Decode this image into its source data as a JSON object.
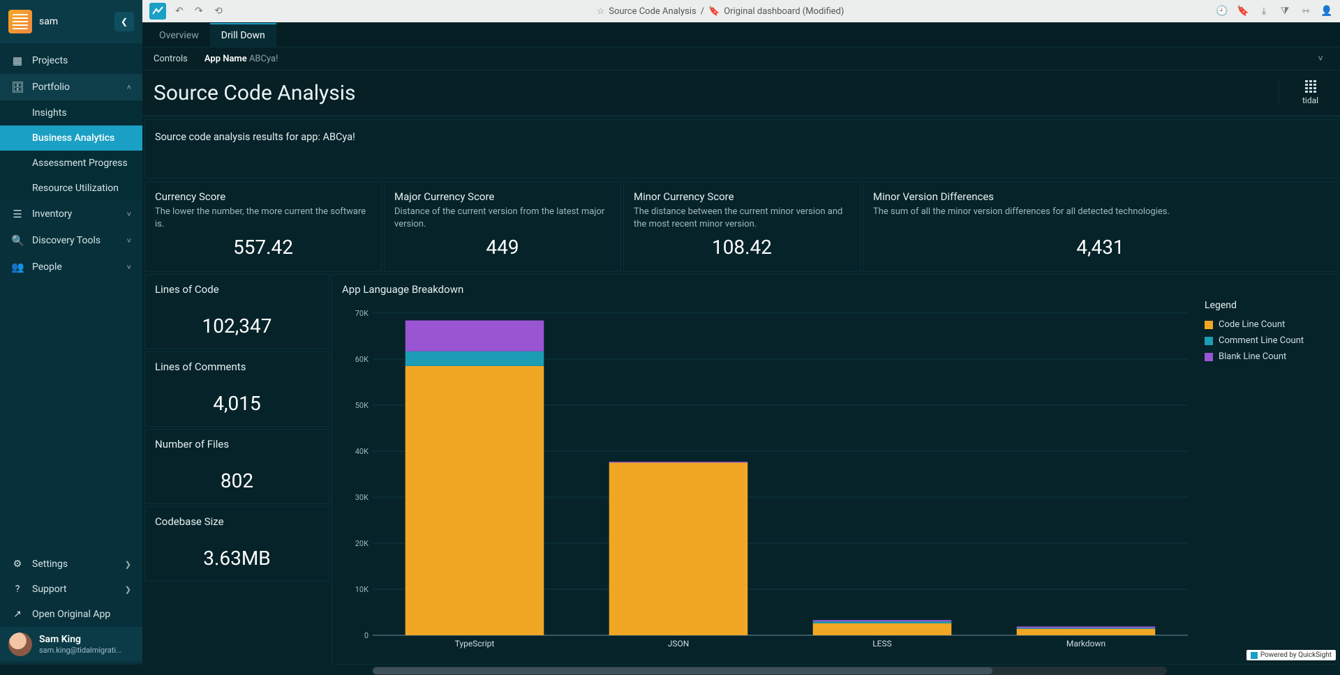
{
  "sidebar": {
    "user_short": "sam",
    "items": [
      {
        "icon": "▦",
        "label": "Projects",
        "expandable": false
      },
      {
        "icon": "🗄",
        "label": "Portfolio",
        "expandable": true,
        "expanded": true,
        "children": [
          {
            "label": "Insights",
            "active": false
          },
          {
            "label": "Business Analytics",
            "active": true
          },
          {
            "label": "Assessment Progress",
            "active": false
          },
          {
            "label": "Resource Utilization",
            "active": false
          }
        ]
      },
      {
        "icon": "☰",
        "label": "Inventory",
        "expandable": true
      },
      {
        "icon": "🔍",
        "label": "Discovery Tools",
        "expandable": true
      },
      {
        "icon": "👥",
        "label": "People",
        "expandable": true
      }
    ],
    "footer": [
      {
        "icon": "⚙",
        "label": "Settings",
        "chev": true
      },
      {
        "icon": "?",
        "label": "Support",
        "chev": true
      },
      {
        "icon": "↗",
        "label": "Open Original App",
        "chev": false
      }
    ],
    "profile": {
      "name": "Sam King",
      "email": "sam.king@tidalmigrati..."
    }
  },
  "toolbar": {
    "breadcrumb_main": "Source Code Analysis",
    "breadcrumb_sep": "/",
    "breadcrumb_sub": "Original dashboard (Modified)"
  },
  "tabs": [
    {
      "label": "Overview",
      "active": false
    },
    {
      "label": "Drill Down",
      "active": true
    }
  ],
  "controls": {
    "label": "Controls",
    "param_name": "App Name",
    "param_value": "ABCya!"
  },
  "page": {
    "title": "Source Code Analysis",
    "brand": "tidal",
    "description": "Source code analysis results for app: ABCya!"
  },
  "kpis": [
    {
      "title": "Currency Score",
      "desc": "The lower the number, the more current the software is.",
      "value": "557.42"
    },
    {
      "title": "Major Currency Score",
      "desc": "Distance of the current version from the latest major version.",
      "value": "449"
    },
    {
      "title": "Minor Currency Score",
      "desc": "The distance between the current minor version and the most recent minor version.",
      "value": "108.42"
    },
    {
      "title": "Minor Version Differences",
      "desc": "The sum of all the minor version differences for all detected technologies.",
      "value": "4,431"
    }
  ],
  "stats": [
    {
      "title": "Lines of Code",
      "value": "102,347"
    },
    {
      "title": "Lines of Comments",
      "value": "4,015"
    },
    {
      "title": "Number of Files",
      "value": "802"
    },
    {
      "title": "Codebase Size",
      "value": "3.63MB"
    }
  ],
  "chart": {
    "title": "App Language Breakdown",
    "legend_title": "Legend",
    "legend": [
      {
        "label": "Code Line Count",
        "color": "#f2a724"
      },
      {
        "label": "Comment Line Count",
        "color": "#1d9cb5"
      },
      {
        "label": "Blank Line Count",
        "color": "#9a55d3"
      }
    ]
  },
  "chart_data": {
    "type": "bar",
    "stacked": true,
    "ylabel": "",
    "xlabel": "",
    "ylim": [
      0,
      70000
    ],
    "yticks": [
      0,
      10000,
      20000,
      30000,
      40000,
      50000,
      60000,
      70000
    ],
    "ytick_labels": [
      "0",
      "10K",
      "20K",
      "30K",
      "40K",
      "50K",
      "60K",
      "70K"
    ],
    "categories": [
      "TypeScript",
      "JSON",
      "LESS",
      "Markdown"
    ],
    "series": [
      {
        "name": "Code Line Count",
        "color": "#f2a724",
        "values": [
          58500,
          37500,
          2600,
          1400
        ]
      },
      {
        "name": "Comment Line Count",
        "color": "#1d9cb5",
        "values": [
          3200,
          0,
          400,
          200
        ]
      },
      {
        "name": "Blank Line Count",
        "color": "#9a55d3",
        "values": [
          6700,
          200,
          300,
          300
        ]
      }
    ]
  },
  "colors": {
    "accent": "#1aa0c4",
    "panel": "#062329",
    "panel_border": "#0a3038"
  },
  "powered": "Powered by QuickSight"
}
